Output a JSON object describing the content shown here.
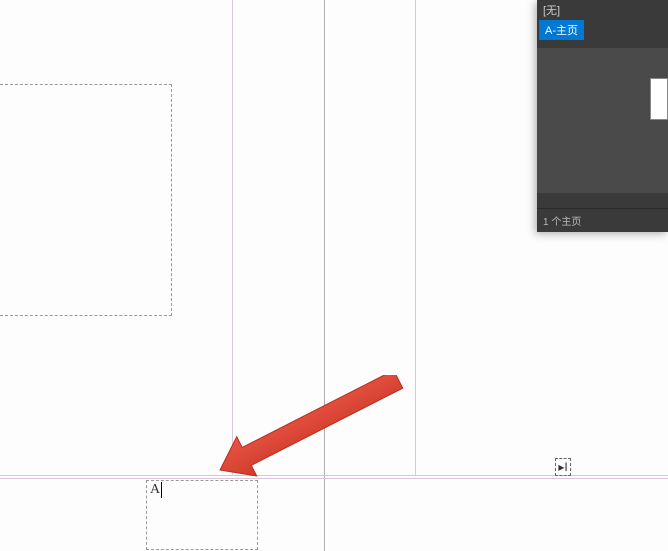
{
  "canvas": {
    "text_input_value": "A"
  },
  "pages_panel": {
    "truncated_header": "[无]",
    "selected_master": "A-主页",
    "footer_text": "1 个主页"
  },
  "cursor": {
    "type": "text-ibeam"
  }
}
